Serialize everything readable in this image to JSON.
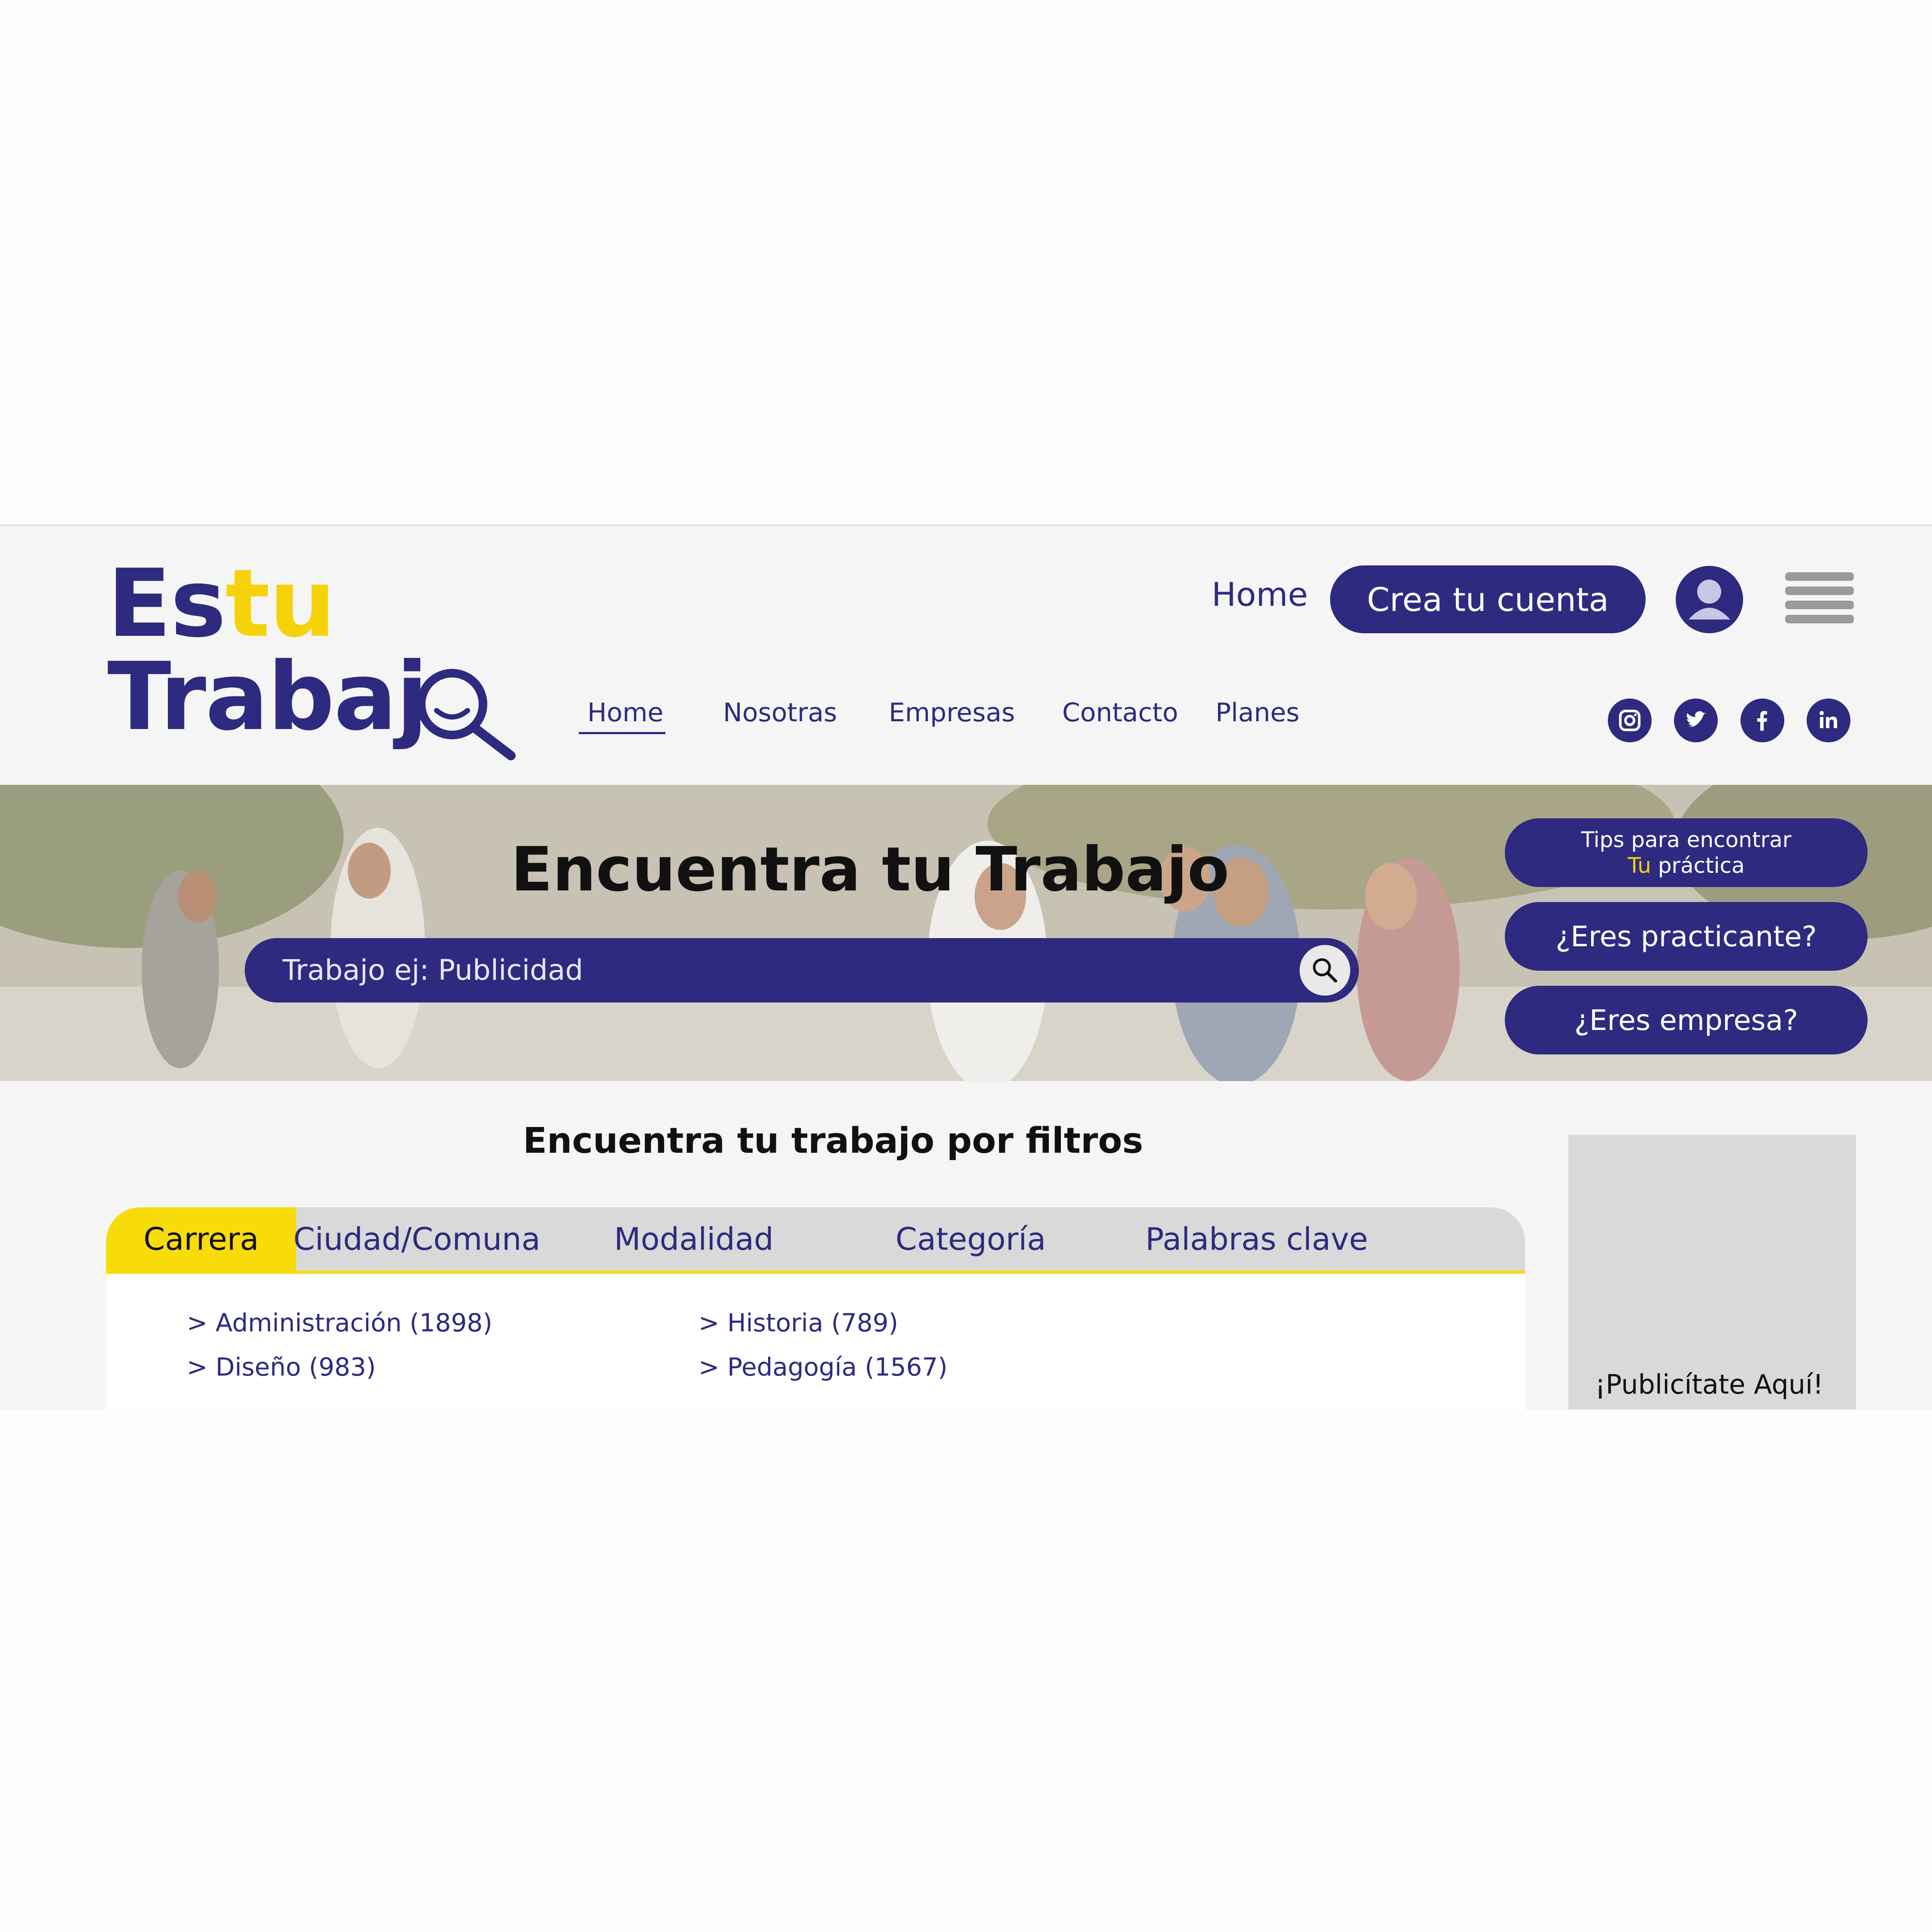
{
  "logo": {
    "line1_a": "Es",
    "line1_b": "tu",
    "line2": "Trabaj"
  },
  "header": {
    "home": "Home",
    "create_account": "Crea tu cuenta"
  },
  "nav": [
    "Home",
    "Nosotras",
    "Empresas",
    "Contacto",
    "Planes"
  ],
  "social": [
    "instagram-icon",
    "twitter-icon",
    "facebook-icon",
    "linkedin-icon"
  ],
  "hero": {
    "title": "Encuentra tu Trabajo",
    "search_placeholder": "Trabajo ej: Publicidad",
    "tips_line1": "Tips para encontrar",
    "tips_tu": "Tu",
    "tips_line2": " práctica",
    "practicante": "¿Eres practicante?",
    "empresa": "¿Eres empresa?"
  },
  "filters": {
    "title": "Encuentra tu trabajo por filtros",
    "tabs": [
      "Carrera",
      "Ciudad/Comuna",
      "Modalidad",
      "Categoría",
      "Palabras clave"
    ],
    "col1": [
      "> Administración (1898)",
      "> Diseño (983)"
    ],
    "col2": [
      "> Historia (789)",
      "> Pedagogía (1567)"
    ]
  },
  "ad": {
    "text": "¡Publicítate Aquí!"
  },
  "colors": {
    "primary": "#2e2a80",
    "accent": "#f8dc0a"
  }
}
